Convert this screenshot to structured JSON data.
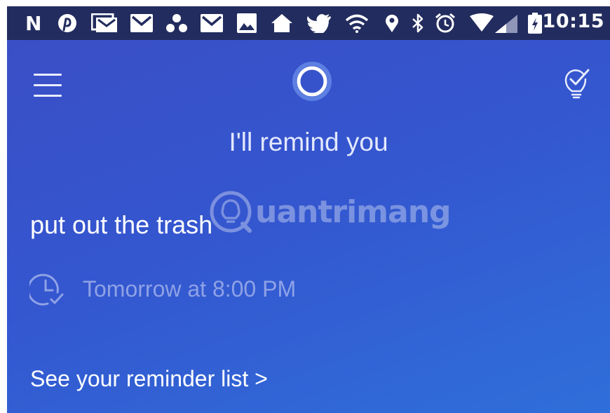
{
  "status_bar": {
    "time": "10:15",
    "icons": [
      "netflix-icon",
      "pinterest-icon",
      "gmail-stack-icon",
      "gmail-icon",
      "dots-icon",
      "gmail-icon",
      "image-icon",
      "home-icon",
      "twitter-icon",
      "wifi-icon",
      "location-icon",
      "bluetooth-icon",
      "alarm-icon",
      "signal-icon",
      "battery-icon"
    ],
    "netflix_letter": "N"
  },
  "toolbar": {
    "menu_icon": "hamburger-menu-icon",
    "assistant_icon": "cortana-ring-icon",
    "tips_icon": "lightbulb-check-icon"
  },
  "reminder": {
    "heading": "I'll remind you",
    "task": "put out the trash",
    "when": "Tomorrow at 8:00 PM",
    "when_icon": "clock-check-icon"
  },
  "footer": {
    "link": "See your reminder list >"
  },
  "watermark": {
    "text": "uantrimang"
  },
  "colors": {
    "status_bar": "#222c5e",
    "background_top": "#3a4fc6",
    "background_bottom": "#2f6fda",
    "secondary_text": "#8fa2e6"
  }
}
